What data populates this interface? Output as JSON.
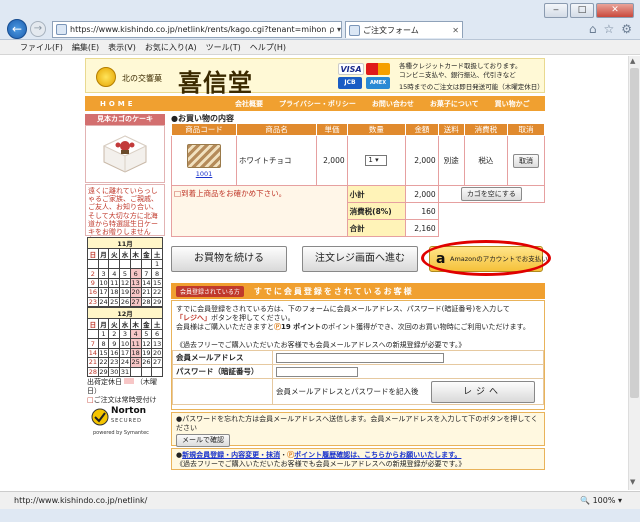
{
  "browser": {
    "url": "https://www.kishindo.co.jp/netlink/rents/kago.cgi?tenant=mihon",
    "addr_tools": "ρ ▾ 🔒 C",
    "tab_title": "ご注文フォーム",
    "menu": [
      "ファイル(F)",
      "編集(E)",
      "表示(V)",
      "お気に入り(A)",
      "ツール(T)",
      "ヘルプ(H)"
    ],
    "status_url": "http://www.kishindo.co.jp/netlink/",
    "zoom": "100%"
  },
  "header": {
    "logo_small": "北の交響菓",
    "logo_big": "喜信堂",
    "cards": [
      "VISA",
      "",
      "JCB",
      "AMEX"
    ],
    "notes": [
      "各種クレジットカード取扱しております。",
      "コンビニ支払や、銀行振込、代引きなど",
      "15時までのご注文は即日発送可能（木曜定休日）"
    ]
  },
  "nav": {
    "home": "HOME",
    "items": [
      "会社概要",
      "プライバシー・ポリシー",
      "お問い合わせ",
      "お菓子について",
      "買い物かご"
    ]
  },
  "sidebar": {
    "title": "見本カゴのケーキ",
    "message": "遠くに離れていらっしゃるご家族、ご親戚、ご友人、お知り合い、そして大切な方に北海道から特選誕生日ケーキをお贈りしませんか。",
    "cal1": {
      "month": "11月",
      "weekdays": [
        "日",
        "月",
        "火",
        "水",
        "木",
        "金",
        "土"
      ],
      "rows": [
        [
          "",
          "",
          "",
          "",
          "",
          "",
          "1"
        ],
        [
          "2",
          "3",
          "4",
          "5",
          "6",
          "7",
          "8"
        ],
        [
          "9",
          "10",
          "11",
          "12",
          "13",
          "14",
          "15"
        ],
        [
          "16",
          "17",
          "18",
          "19",
          "20",
          "21",
          "22"
        ],
        [
          "23",
          "24",
          "25",
          "26",
          "27",
          "28",
          "29"
        ],
        [
          "30",
          "",
          "",
          "",
          "",
          "",
          ""
        ]
      ]
    },
    "cal2": {
      "month": "12月",
      "weekdays": [
        "日",
        "月",
        "火",
        "水",
        "木",
        "金",
        "土"
      ],
      "rows": [
        [
          "",
          "1",
          "2",
          "3",
          "4",
          "5",
          "6"
        ],
        [
          "7",
          "8",
          "9",
          "10",
          "11",
          "12",
          "13"
        ],
        [
          "14",
          "15",
          "16",
          "17",
          "18",
          "19",
          "20"
        ],
        [
          "21",
          "22",
          "23",
          "24",
          "25",
          "26",
          "27"
        ],
        [
          "28",
          "29",
          "30",
          "31",
          "",
          "",
          ""
        ]
      ]
    },
    "cal_note_1": "出荷定休日",
    "cal_note_2": "（木曜日）",
    "cal_note_3": "ご注文は常時受付け",
    "norton": [
      "Norton",
      "SECURED",
      "powered by Symantec"
    ]
  },
  "cart": {
    "title": "●お買い物の内容",
    "headers": [
      "商品コード",
      "商品名",
      "単価",
      "数量",
      "金額",
      "送料",
      "消費税",
      "取消"
    ],
    "item": {
      "code": "1001",
      "name": "ホワイトチョコ",
      "price": "2,000",
      "qty": "1",
      "amount": "2,000",
      "shipping": "別途",
      "tax": "税込",
      "cancel": "取消"
    },
    "note": "□到着上商品をお確かめ下さい。",
    "subtotal_label": "小計",
    "subtotal": "2,000",
    "empty_cart": "カゴを空にする",
    "tax_label": "消費税(8%)",
    "tax_value": "160",
    "total_label": "合計",
    "total": "2,160"
  },
  "actions": {
    "continue": "お買物を続ける",
    "checkout": "注文レジ画面へ進む",
    "amazon_logo": "a",
    "amazon": "Amazonのアカウントでお支払い"
  },
  "member": {
    "badge": "会員登録されている方",
    "title": "すでに会員登録をされているお客様",
    "desc_1": "すでに会員登録をされている方は、下のフォームに会員メールアドレス、パスワード(暗証番号)を入力して",
    "desc_red": "「レジへ」",
    "desc_2": "ボタンを押してください。",
    "desc_3": "会員様はご購入いただきますと",
    "points": "19 ポイント",
    "desc_4": "のポイント獲得ができ、次回のお買い物時にご利用いただけます。",
    "free": "《過去フリーでご購入いただいたお客様でも会員メールアドレスへの新規登録が必要です。》",
    "email_label": "会員メールアドレス",
    "password_label": "パスワード（暗証番号）",
    "instruction": "会員メールアドレスとパスワードを記入後",
    "register": "レジへ"
  },
  "forgot": {
    "text": "●パスワードを忘れた方は会員メールアドレスへ送信します。会員メールアドレスを入力して下のボタンを押してください",
    "button": "メールで確認"
  },
  "newreg": {
    "prefix": "●",
    "link": "新規会員登録・内容変更・抹消",
    "mid": "・",
    "points_link": "ポイント履歴確認は、こちらからお願いいたします。",
    "note": "《過去フリーでご購入いただいたお客様でも会員メールアドレスへの新規登録が必要です。》"
  },
  "colors": {
    "accent": "#f0a030",
    "sidebar": "#d36f6f",
    "amazon": "#f5c13a"
  }
}
